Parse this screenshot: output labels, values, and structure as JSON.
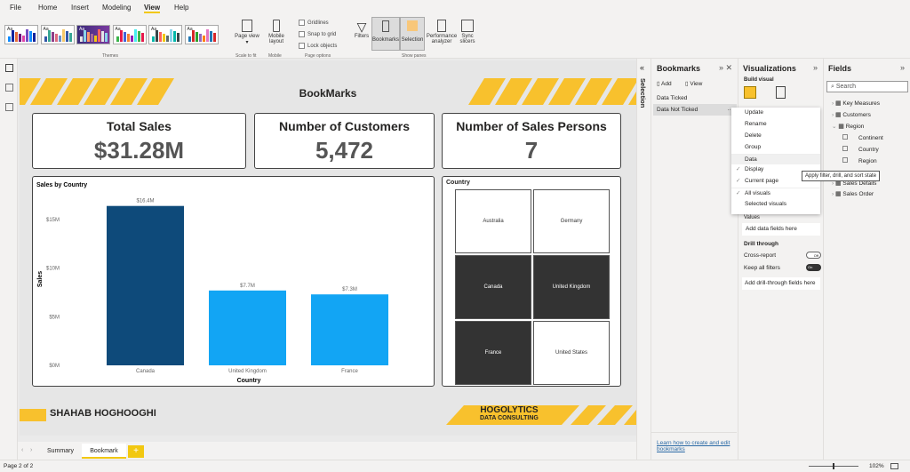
{
  "menu": [
    "File",
    "Home",
    "Insert",
    "Modeling",
    "View",
    "Help"
  ],
  "ribbon": {
    "themes_label": "Themes",
    "page_view": "Page view",
    "scale_to_fit": "Scale to fit",
    "mobile_layout": "Mobile layout",
    "mobile": "Mobile",
    "gridlines": "Gridlines",
    "snap": "Snap to grid",
    "lock": "Lock objects",
    "page_options": "Page options",
    "filters": "Filters",
    "bookmarks": "Bookmarks",
    "selection": "Selection",
    "performance": "Performance analyzer",
    "sync": "Sync slicers",
    "show_panes": "Show panes",
    "theme_aa": "Aa"
  },
  "report": {
    "title": "BookMarks",
    "kpis": [
      {
        "label": "Total Sales",
        "value": "$31.28M"
      },
      {
        "label": "Number of Customers",
        "value": "5,472"
      },
      {
        "label": "Number of Sales Persons",
        "value": "7"
      }
    ],
    "footer_name": "SHAHAB HOGHOOGHI",
    "logo_main": "HOGOLYTICS",
    "logo_sub": "DATA CONSULTING",
    "treemap": {
      "title": "Country",
      "cells": [
        {
          "label": "Australia",
          "selected": false
        },
        {
          "label": "Germany",
          "selected": false
        },
        {
          "label": "Canada",
          "selected": true
        },
        {
          "label": "United Kingdom",
          "selected": true
        },
        {
          "label": "France",
          "selected": true
        },
        {
          "label": "United States",
          "selected": false
        }
      ]
    }
  },
  "chart_data": {
    "type": "bar",
    "title": "Sales by Country",
    "xlabel": "Country",
    "ylabel": "Sales",
    "categories": [
      "Canada",
      "United Kingdom",
      "France"
    ],
    "values": [
      16.4,
      7.7,
      7.3
    ],
    "data_labels": [
      "$16.4M",
      "$7.7M",
      "$7.3M"
    ],
    "yticks": [
      "$0M",
      "$5M",
      "$10M",
      "$15M"
    ],
    "ylim": [
      0,
      17.5
    ],
    "colors": [
      "#0e4a7a",
      "#12a5f4",
      "#12a5f4"
    ],
    "grid": false
  },
  "page_tabs": [
    "Summary",
    "Bookmark"
  ],
  "add_tab": "+",
  "selection_pane": "Selection",
  "bookmarks": {
    "title": "Bookmarks",
    "add": "Add",
    "view": "View",
    "items": [
      "Data Ticked",
      "Data Not Ticked"
    ],
    "learn": "Learn how to create and edit bookmarks",
    "more": "···"
  },
  "context_menu": [
    {
      "label": "Update",
      "check": ""
    },
    {
      "label": "Rename",
      "check": ""
    },
    {
      "label": "Delete",
      "check": ""
    },
    {
      "label": "Group",
      "check": ""
    },
    {
      "label": "Data",
      "check": ""
    },
    {
      "label": "Display",
      "check": "✓"
    },
    {
      "label": "Current page",
      "check": "✓"
    },
    {
      "label": "All visuals",
      "check": "✓"
    },
    {
      "label": "Selected visuals",
      "check": ""
    }
  ],
  "tooltip": "Apply filter, drill, and sort state",
  "viz": {
    "title": "Visualizations",
    "build": "Build visual",
    "values": "Values",
    "add_fields": "Add data fields here",
    "drill": "Drill through",
    "cross": "Cross-report",
    "cross_state": "Off",
    "keep": "Keep all filters",
    "keep_state": "On",
    "add_drill": "Add drill-through fields here"
  },
  "fields": {
    "title": "Fields",
    "search_placeholder": "Search",
    "tables": [
      "Key Measures",
      "Customers",
      "Region",
      "Sales Details",
      "Sales Order"
    ],
    "region_cols": [
      "Continent",
      "Country",
      "Region"
    ]
  },
  "status": {
    "page": "Page 2 of 2",
    "zoom": "102%"
  },
  "colors": {
    "accent": "#f8c12d",
    "dark": "#0e4a7a",
    "light": "#12a5f4"
  }
}
